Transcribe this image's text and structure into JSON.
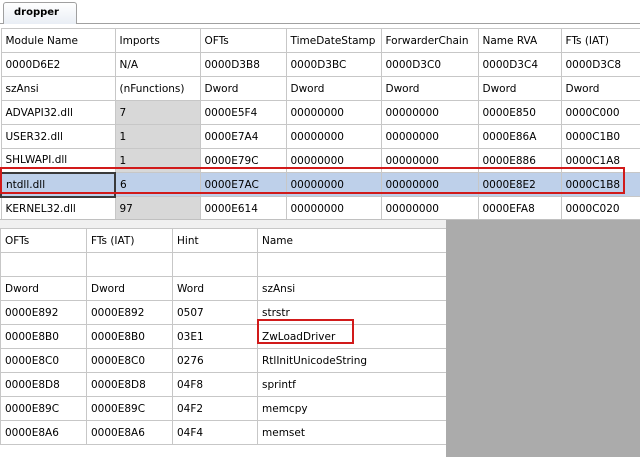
{
  "tab": {
    "label": "dropper"
  },
  "import_directory": {
    "headers": [
      "Module Name",
      "Imports",
      "OFTs",
      "TimeDateStamp",
      "ForwarderChain",
      "Name RVA",
      "FTs (IAT)"
    ],
    "offsets": [
      "0000D6E2",
      "N/A",
      "0000D3B8",
      "0000D3BC",
      "0000D3C0",
      "0000D3C4",
      "0000D3C8"
    ],
    "types": [
      "szAnsi",
      "(nFunctions)",
      "Dword",
      "Dword",
      "Dword",
      "Dword",
      "Dword"
    ],
    "rows": [
      [
        "ADVAPI32.dll",
        "7",
        "0000E5F4",
        "00000000",
        "00000000",
        "0000E850",
        "0000C000"
      ],
      [
        "USER32.dll",
        "1",
        "0000E7A4",
        "00000000",
        "00000000",
        "0000E86A",
        "0000C1B0"
      ],
      [
        "SHLWAPI.dll",
        "1",
        "0000E79C",
        "00000000",
        "00000000",
        "0000E886",
        "0000C1A8"
      ],
      [
        "ntdll.dll",
        "6",
        "0000E7AC",
        "00000000",
        "00000000",
        "0000E8E2",
        "0000C1B8"
      ],
      [
        "KERNEL32.dll",
        "97",
        "0000E614",
        "00000000",
        "00000000",
        "0000EFA8",
        "0000C020"
      ]
    ],
    "selected_row": 3
  },
  "functions": {
    "headers": [
      "OFTs",
      "FTs (IAT)",
      "Hint",
      "Name"
    ],
    "offsets": [
      "",
      "",
      "",
      ""
    ],
    "types": [
      "Dword",
      "Dword",
      "Word",
      "szAnsi"
    ],
    "rows": [
      [
        "0000E892",
        "0000E892",
        "0507",
        "strstr"
      ],
      [
        "0000E8B0",
        "0000E8B0",
        "03E1",
        "ZwLoadDriver"
      ],
      [
        "0000E8C0",
        "0000E8C0",
        "0276",
        "RtlInitUnicodeString"
      ],
      [
        "0000E8D8",
        "0000E8D8",
        "04F8",
        "sprintf"
      ],
      [
        "0000E89C",
        "0000E89C",
        "04F2",
        "memcpy"
      ],
      [
        "0000E8A6",
        "0000E8A6",
        "04F4",
        "memset"
      ]
    ],
    "highlighted": "ZwLoadDriver"
  },
  "colors": {
    "selection": "#bed0ea",
    "highlight_border": "#d11a1a",
    "gray_cell": "#d8d8d8",
    "empty_area": "#ababab"
  }
}
